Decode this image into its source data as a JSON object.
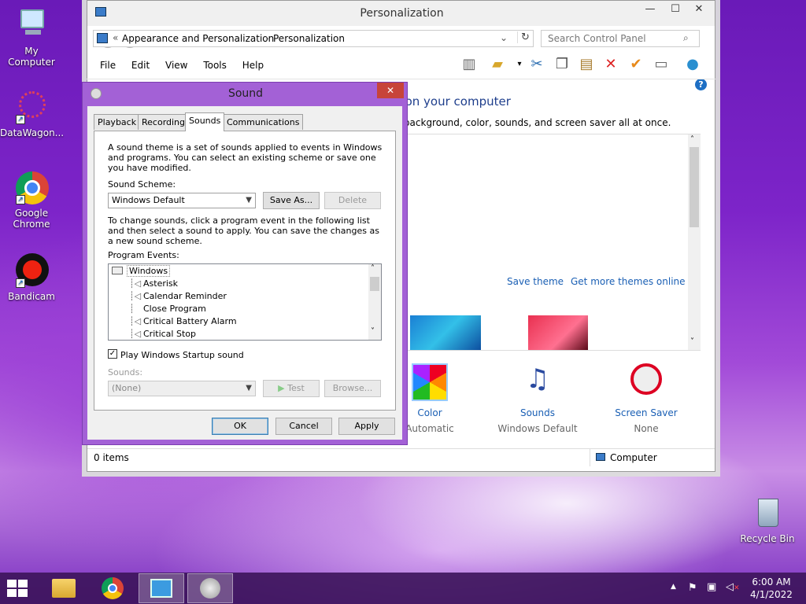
{
  "desktop": {
    "icons": [
      {
        "label": "My Computer"
      },
      {
        "label": "DataWagon..."
      },
      {
        "label": "Google Chrome"
      },
      {
        "label": "Bandicam"
      },
      {
        "label": "Recycle Bin"
      }
    ]
  },
  "control_panel": {
    "title": "Personalization",
    "address": {
      "prefix": "«",
      "crumb1": "Appearance and Personalization",
      "crumb2": "Personalization"
    },
    "search_placeholder": "Search Control Panel",
    "menu": [
      "File",
      "Edit",
      "View",
      "Tools",
      "Help"
    ],
    "heading": "...ounds on your computer",
    "subheading": "...top background, color, sounds, and screen saver all at once.",
    "save_theme": "Save theme",
    "get_more_themes": "Get more themes online",
    "bottom_items": [
      {
        "label": "Color",
        "value": "Automatic"
      },
      {
        "label": "Sounds",
        "value": "Windows Default"
      },
      {
        "label": "Screen Saver",
        "value": "None"
      }
    ],
    "status_left": "0 items",
    "status_right": "Computer"
  },
  "sound_dialog": {
    "title": "Sound",
    "tabs": [
      "Playback",
      "Recording",
      "Sounds",
      "Communications"
    ],
    "active_tab": "Sounds",
    "intro": "A sound theme is a set of sounds applied to events in Windows and programs.  You can select an existing scheme or save one you have modified.",
    "scheme_label": "Sound Scheme:",
    "scheme_value": "Windows Default",
    "save_as": "Save As...",
    "delete": "Delete",
    "change_text": "To change sounds, click a program event in the following list and then select a sound to apply.  You can save the changes as a new sound scheme.",
    "events_label": "Program Events:",
    "events": [
      "Windows",
      "Asterisk",
      "Calendar Reminder",
      "Close Program",
      "Critical Battery Alarm",
      "Critical Stop"
    ],
    "startup_label": "Play Windows Startup sound",
    "startup_checked": true,
    "sounds_label": "Sounds:",
    "sounds_value": "(None)",
    "test": "Test",
    "browse": "Browse...",
    "ok": "OK",
    "cancel": "Cancel",
    "apply": "Apply"
  },
  "taskbar": {
    "time": "6:00 AM",
    "date": "4/1/2022"
  }
}
